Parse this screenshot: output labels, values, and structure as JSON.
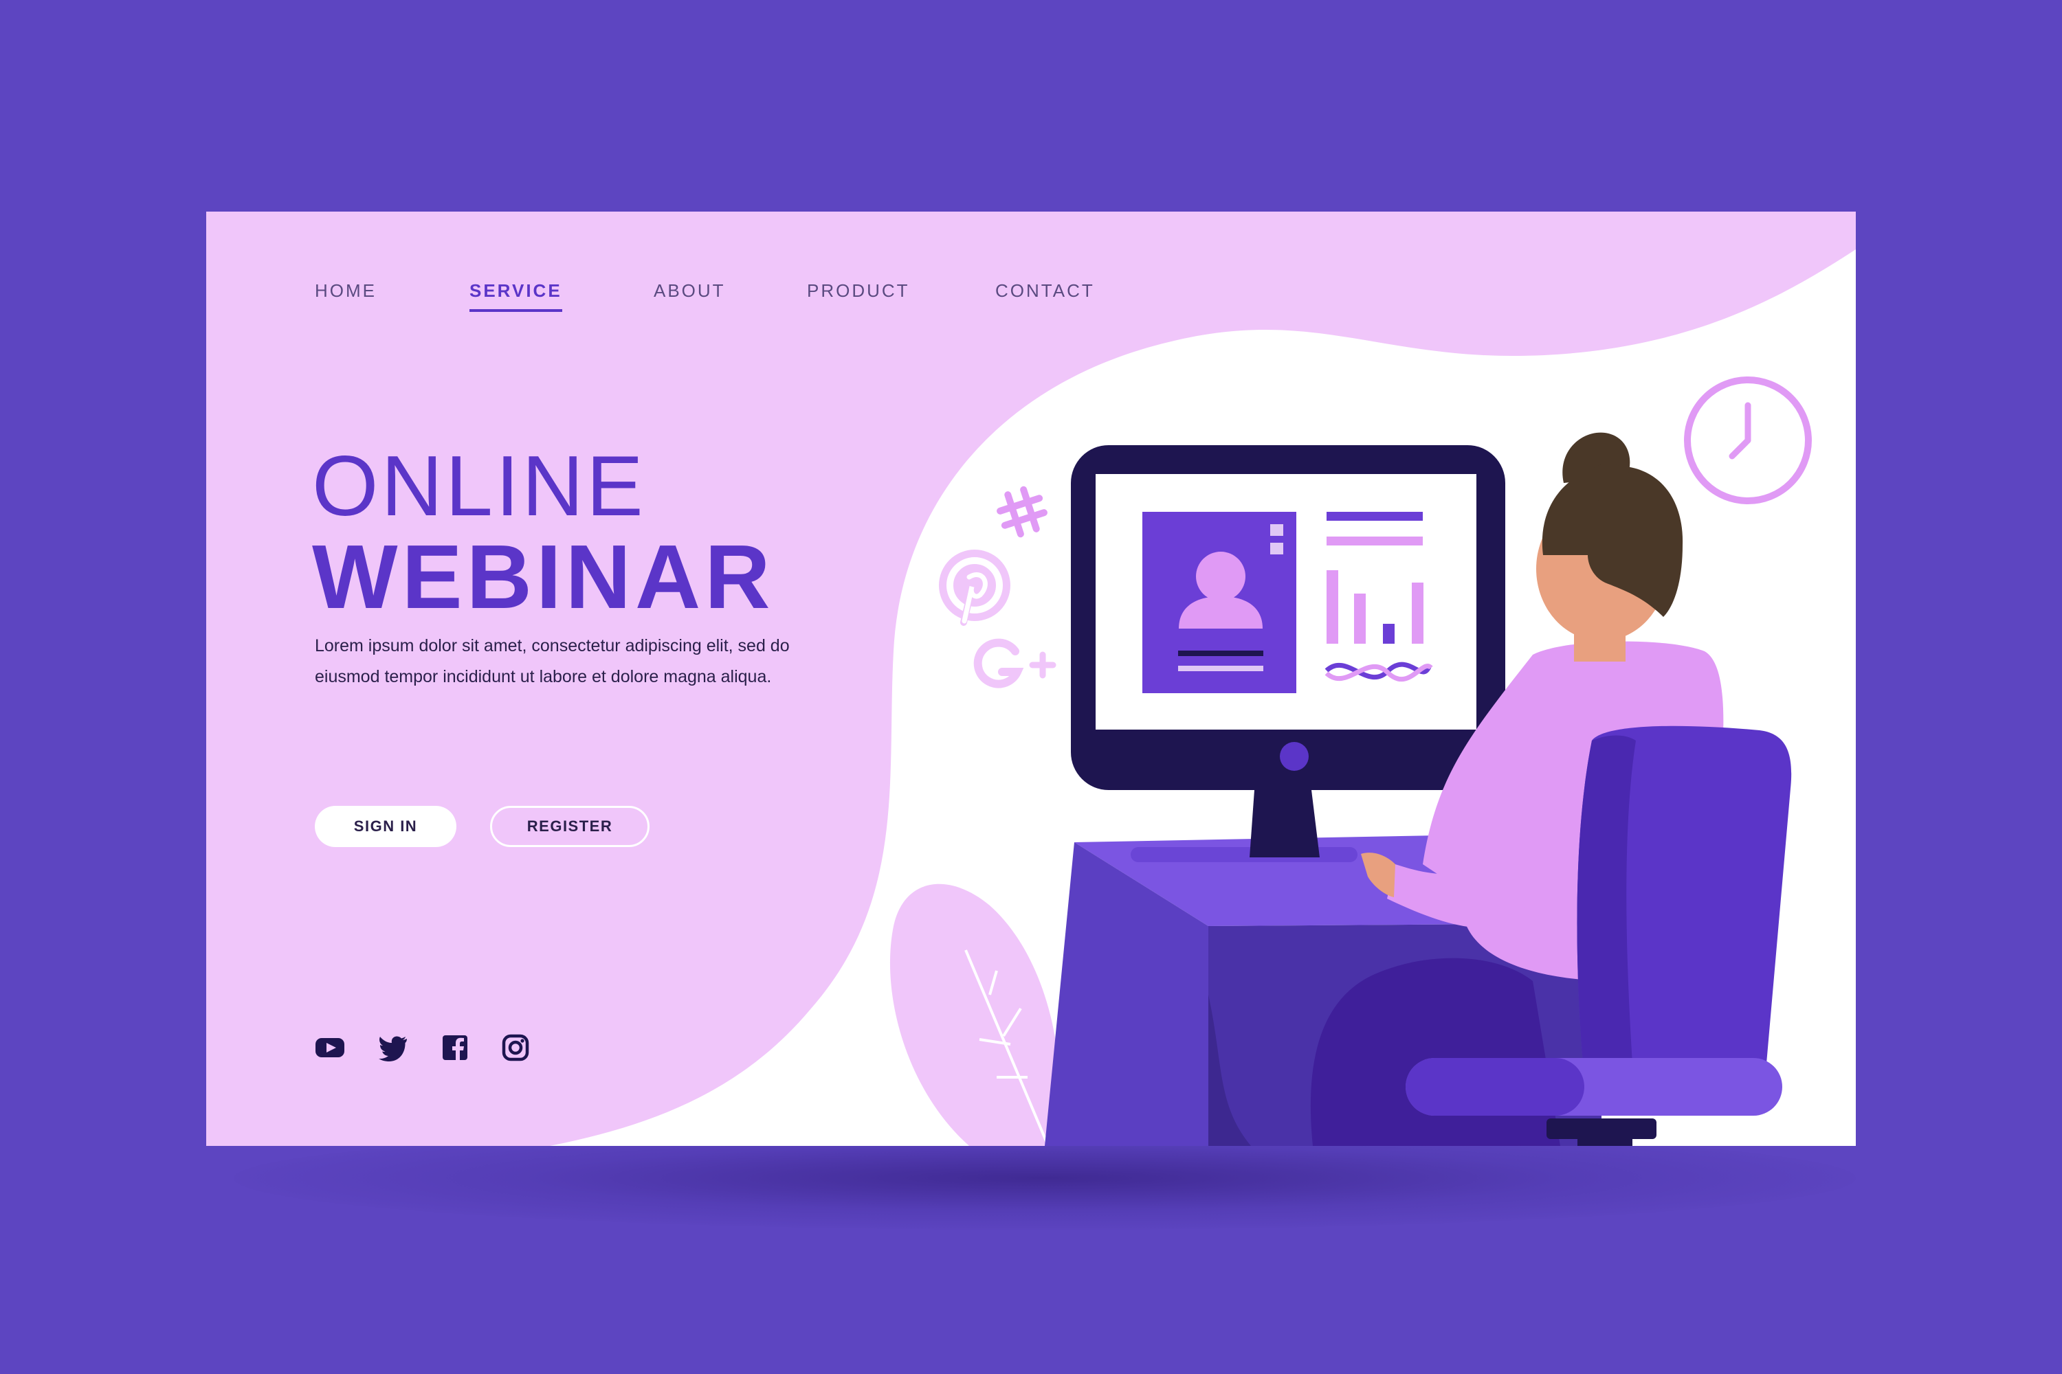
{
  "nav": {
    "items": [
      {
        "label": "HOME",
        "active": false
      },
      {
        "label": "SERVICE",
        "active": true
      },
      {
        "label": "ABOUT",
        "active": false
      },
      {
        "label": "PRODUCT",
        "active": false
      },
      {
        "label": "CONTACT",
        "active": false
      }
    ]
  },
  "hero": {
    "title_line1": "ONLINE",
    "title_line2": "WEBINAR",
    "description": "Lorem ipsum dolor sit amet, consectetur adipiscing elit, sed do eiusmod tempor incididunt ut labore et dolore magna aliqua."
  },
  "buttons": {
    "sign_in": "SIGN IN",
    "register": "REGISTER"
  },
  "social": [
    "youtube-icon",
    "twitter-icon",
    "facebook-icon",
    "instagram-icon"
  ],
  "floating_icons": [
    "hashtag-icon",
    "pinterest-icon",
    "google-plus-icon",
    "clock-icon"
  ],
  "colors": {
    "background": "#5d45c1",
    "panel_pink": "#f0c6fa",
    "primary": "#5b35c8",
    "accent": "#e09af5",
    "dark": "#1e1550"
  }
}
